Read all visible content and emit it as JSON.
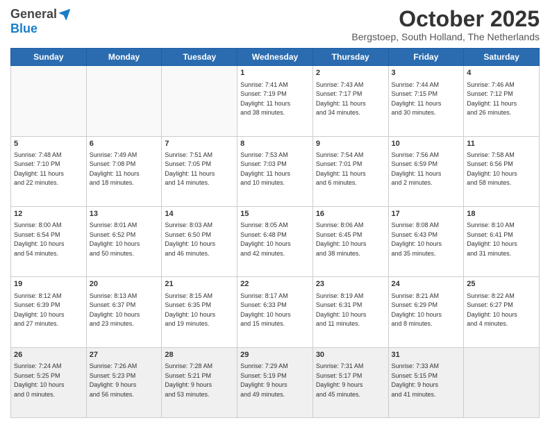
{
  "header": {
    "logo_general": "General",
    "logo_blue": "Blue",
    "month_title": "October 2025",
    "subtitle": "Bergstoep, South Holland, The Netherlands"
  },
  "days_of_week": [
    "Sunday",
    "Monday",
    "Tuesday",
    "Wednesday",
    "Thursday",
    "Friday",
    "Saturday"
  ],
  "weeks": [
    [
      {
        "day": "",
        "info": ""
      },
      {
        "day": "",
        "info": ""
      },
      {
        "day": "",
        "info": ""
      },
      {
        "day": "1",
        "info": "Sunrise: 7:41 AM\nSunset: 7:19 PM\nDaylight: 11 hours\nand 38 minutes."
      },
      {
        "day": "2",
        "info": "Sunrise: 7:43 AM\nSunset: 7:17 PM\nDaylight: 11 hours\nand 34 minutes."
      },
      {
        "day": "3",
        "info": "Sunrise: 7:44 AM\nSunset: 7:15 PM\nDaylight: 11 hours\nand 30 minutes."
      },
      {
        "day": "4",
        "info": "Sunrise: 7:46 AM\nSunset: 7:12 PM\nDaylight: 11 hours\nand 26 minutes."
      }
    ],
    [
      {
        "day": "5",
        "info": "Sunrise: 7:48 AM\nSunset: 7:10 PM\nDaylight: 11 hours\nand 22 minutes."
      },
      {
        "day": "6",
        "info": "Sunrise: 7:49 AM\nSunset: 7:08 PM\nDaylight: 11 hours\nand 18 minutes."
      },
      {
        "day": "7",
        "info": "Sunrise: 7:51 AM\nSunset: 7:05 PM\nDaylight: 11 hours\nand 14 minutes."
      },
      {
        "day": "8",
        "info": "Sunrise: 7:53 AM\nSunset: 7:03 PM\nDaylight: 11 hours\nand 10 minutes."
      },
      {
        "day": "9",
        "info": "Sunrise: 7:54 AM\nSunset: 7:01 PM\nDaylight: 11 hours\nand 6 minutes."
      },
      {
        "day": "10",
        "info": "Sunrise: 7:56 AM\nSunset: 6:59 PM\nDaylight: 11 hours\nand 2 minutes."
      },
      {
        "day": "11",
        "info": "Sunrise: 7:58 AM\nSunset: 6:56 PM\nDaylight: 10 hours\nand 58 minutes."
      }
    ],
    [
      {
        "day": "12",
        "info": "Sunrise: 8:00 AM\nSunset: 6:54 PM\nDaylight: 10 hours\nand 54 minutes."
      },
      {
        "day": "13",
        "info": "Sunrise: 8:01 AM\nSunset: 6:52 PM\nDaylight: 10 hours\nand 50 minutes."
      },
      {
        "day": "14",
        "info": "Sunrise: 8:03 AM\nSunset: 6:50 PM\nDaylight: 10 hours\nand 46 minutes."
      },
      {
        "day": "15",
        "info": "Sunrise: 8:05 AM\nSunset: 6:48 PM\nDaylight: 10 hours\nand 42 minutes."
      },
      {
        "day": "16",
        "info": "Sunrise: 8:06 AM\nSunset: 6:45 PM\nDaylight: 10 hours\nand 38 minutes."
      },
      {
        "day": "17",
        "info": "Sunrise: 8:08 AM\nSunset: 6:43 PM\nDaylight: 10 hours\nand 35 minutes."
      },
      {
        "day": "18",
        "info": "Sunrise: 8:10 AM\nSunset: 6:41 PM\nDaylight: 10 hours\nand 31 minutes."
      }
    ],
    [
      {
        "day": "19",
        "info": "Sunrise: 8:12 AM\nSunset: 6:39 PM\nDaylight: 10 hours\nand 27 minutes."
      },
      {
        "day": "20",
        "info": "Sunrise: 8:13 AM\nSunset: 6:37 PM\nDaylight: 10 hours\nand 23 minutes."
      },
      {
        "day": "21",
        "info": "Sunrise: 8:15 AM\nSunset: 6:35 PM\nDaylight: 10 hours\nand 19 minutes."
      },
      {
        "day": "22",
        "info": "Sunrise: 8:17 AM\nSunset: 6:33 PM\nDaylight: 10 hours\nand 15 minutes."
      },
      {
        "day": "23",
        "info": "Sunrise: 8:19 AM\nSunset: 6:31 PM\nDaylight: 10 hours\nand 11 minutes."
      },
      {
        "day": "24",
        "info": "Sunrise: 8:21 AM\nSunset: 6:29 PM\nDaylight: 10 hours\nand 8 minutes."
      },
      {
        "day": "25",
        "info": "Sunrise: 8:22 AM\nSunset: 6:27 PM\nDaylight: 10 hours\nand 4 minutes."
      }
    ],
    [
      {
        "day": "26",
        "info": "Sunrise: 7:24 AM\nSunset: 5:25 PM\nDaylight: 10 hours\nand 0 minutes."
      },
      {
        "day": "27",
        "info": "Sunrise: 7:26 AM\nSunset: 5:23 PM\nDaylight: 9 hours\nand 56 minutes."
      },
      {
        "day": "28",
        "info": "Sunrise: 7:28 AM\nSunset: 5:21 PM\nDaylight: 9 hours\nand 53 minutes."
      },
      {
        "day": "29",
        "info": "Sunrise: 7:29 AM\nSunset: 5:19 PM\nDaylight: 9 hours\nand 49 minutes."
      },
      {
        "day": "30",
        "info": "Sunrise: 7:31 AM\nSunset: 5:17 PM\nDaylight: 9 hours\nand 45 minutes."
      },
      {
        "day": "31",
        "info": "Sunrise: 7:33 AM\nSunset: 5:15 PM\nDaylight: 9 hours\nand 41 minutes."
      },
      {
        "day": "",
        "info": ""
      }
    ]
  ]
}
